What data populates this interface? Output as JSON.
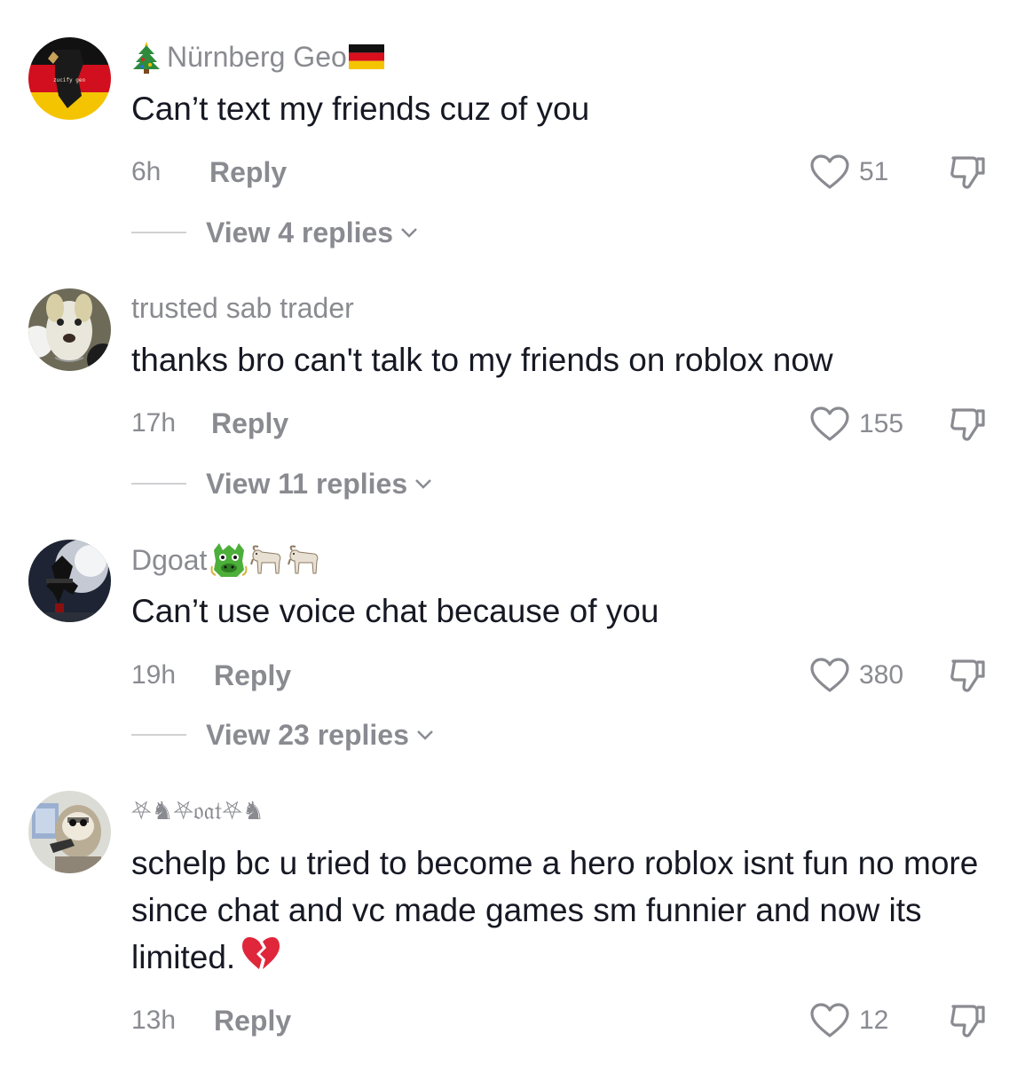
{
  "comments": [
    {
      "username": "Nürnberg Geo",
      "avatar_text": "zucify geo",
      "prefix_icon": "christmas-tree-icon",
      "suffix_icon": "german-flag-icon",
      "text": "Can’t text my friends cuz of you",
      "time": "6h",
      "reply_label": "Reply",
      "likes": "51",
      "view_replies": "View 4 replies"
    },
    {
      "username": "trusted sab trader",
      "text": "thanks bro can't talk to my friends on roblox now",
      "time": "17h",
      "reply_label": "Reply",
      "likes": "155",
      "view_replies": "View 11 replies"
    },
    {
      "username": "Dgoat",
      "suffix_icon": "dragon-face-and-goat-icons",
      "text": "Can’t use voice chat because of you",
      "time": "19h",
      "reply_label": "Reply",
      "likes": "380",
      "view_replies": "View 23 replies"
    },
    {
      "username": "⛧♞⛧𝔬𝔞𝔱⛧♞",
      "text": "schelp bc u tried to become a hero roblox isnt fun no more since chat and vc made games sm funnier and now its limited.",
      "trailing_icon": "broken-heart-icon",
      "time": "13h",
      "reply_label": "Reply",
      "likes": "12"
    }
  ],
  "colors": {
    "secondary_text": "#8a8b91",
    "primary_text": "#161823",
    "divider": "#d0d1d3",
    "broken_heart": "#e0263a"
  }
}
